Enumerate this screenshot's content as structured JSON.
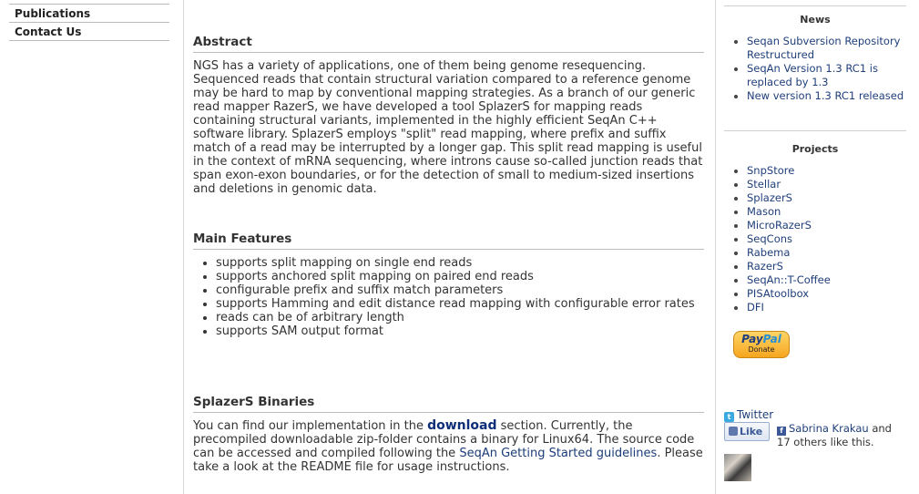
{
  "nav": {
    "items": [
      {
        "label": "Publications"
      },
      {
        "label": "Contact Us"
      }
    ]
  },
  "main": {
    "abstract": {
      "heading": "Abstract",
      "text": "NGS has a variety of applications, one of them being genome resequencing. Sequenced reads that contain structural variation compared to a reference genome may be hard to map by conventional mapping strategies. As a branch of our generic read mapper RazerS, we have developed a tool SplazerS for mapping reads containing structural variants, implemented in the highly efficient SeqAn C++ software library. SplazerS employs \"split\" read mapping, where prefix and suffix match of a read may be interrupted by a longer gap. This split read mapping is useful in the context of mRNA sequencing, where introns cause so-called junction reads that span exon-exon boundaries, or for the detection of small to medium-sized insertions and deletions in genomic data."
    },
    "features": {
      "heading": "Main Features",
      "items": [
        "supports split mapping on single end reads",
        "supports anchored split mapping on paired end reads",
        "configurable prefix and suffix match parameters",
        "supports Hamming and edit distance read mapping with configurable error rates",
        "reads can be of arbitrary length",
        "supports SAM output format"
      ]
    },
    "binaries": {
      "heading": "SplazerS Binaries",
      "text_1": "You can find our implementation in the ",
      "link_download": "download",
      "text_2": " section. Currently, the precompiled downloadable zip-folder contains a binary for Linux64. The source code can be accessed and compiled following the ",
      "link_guidelines": "SeqAn Getting Started guidelines",
      "text_3": ". Please take a look at the README file for usage instructions."
    }
  },
  "sidebar": {
    "news": {
      "title": "News",
      "items": [
        "Seqan Subversion Repository Restructured",
        "SeqAn Version 1.3 RC1 is replaced by 1.3",
        "New version 1.3 RC1 released"
      ]
    },
    "projects": {
      "title": "Projects",
      "items": [
        "SnpStore",
        "Stellar",
        "SplazerS",
        "Mason",
        "MicroRazerS",
        "SeqCons",
        "Rabema",
        "RazerS",
        "SeqAn::T-Coffee",
        "PISAtoolbox",
        "DFI"
      ]
    },
    "paypal": {
      "brand_1": "Pay",
      "brand_2": "Pal",
      "label": "Donate"
    },
    "twitter": {
      "label": "Twitter"
    },
    "facebook": {
      "like_label": "Like",
      "friend_name": "Sabrina Krakau",
      "suffix": " and 17 others like this."
    }
  }
}
